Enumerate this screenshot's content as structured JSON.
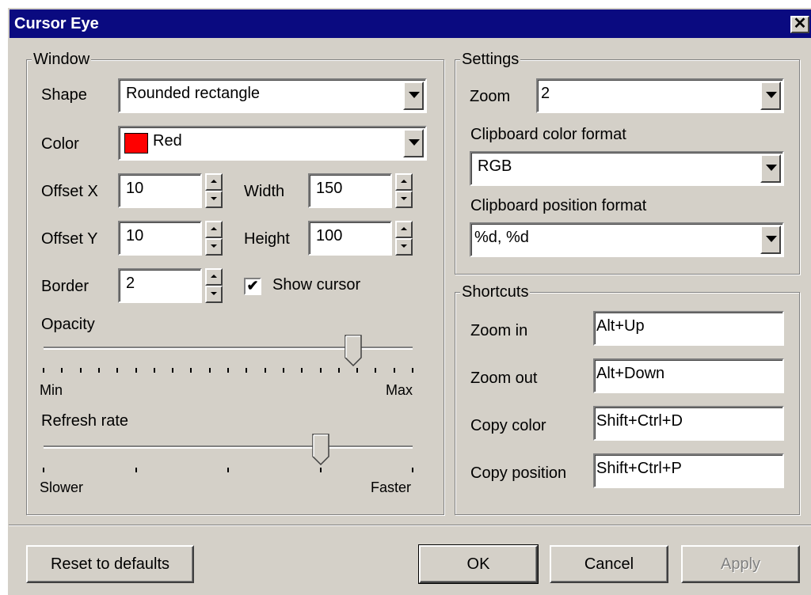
{
  "window": {
    "title": "Cursor Eye",
    "close_glyph": "✕"
  },
  "window_group": {
    "label": "Window",
    "shape_label": "Shape",
    "shape_value": "Rounded rectangle",
    "color_label": "Color",
    "color_value": "Red",
    "color_swatch": "#ff0000",
    "offset_x_label": "Offset X",
    "offset_x_value": "10",
    "offset_y_label": "Offset Y",
    "offset_y_value": "10",
    "width_label": "Width",
    "width_value": "150",
    "height_label": "Height",
    "height_value": "100",
    "border_label": "Border",
    "border_value": "2",
    "show_cursor_label": "Show cursor",
    "show_cursor_checked": true,
    "opacity_label": "Opacity",
    "opacity_min": "Min",
    "opacity_max": "Max",
    "opacity_level": 0.84,
    "refresh_label": "Refresh rate",
    "refresh_min": "Slower",
    "refresh_max": "Faster",
    "refresh_level": 0.75
  },
  "settings_group": {
    "label": "Settings",
    "zoom_label": "Zoom",
    "zoom_value": "2",
    "clip_color_label": "Clipboard color format",
    "clip_color_value": "RGB",
    "clip_pos_label": "Clipboard position format",
    "clip_pos_value": "%d, %d"
  },
  "shortcuts_group": {
    "label": "Shortcuts",
    "zoom_in_label": "Zoom in",
    "zoom_in_value": "Alt+Up",
    "zoom_out_label": "Zoom out",
    "zoom_out_value": "Alt+Down",
    "copy_color_label": "Copy color",
    "copy_color_value": "Shift+Ctrl+D",
    "copy_pos_label": "Copy position",
    "copy_pos_value": "Shift+Ctrl+P"
  },
  "buttons": {
    "reset": "Reset to defaults",
    "ok": "OK",
    "cancel": "Cancel",
    "apply": "Apply"
  },
  "colors": {
    "face": "#d4d0c8",
    "titlebar": "#0a0a80"
  }
}
